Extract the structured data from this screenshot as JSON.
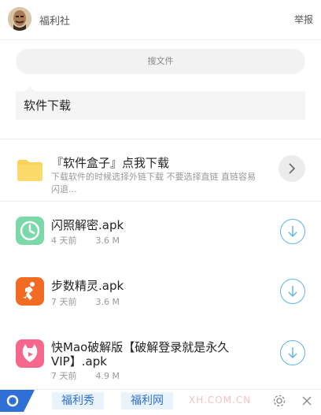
{
  "header": {
    "site_name": "福利社",
    "report_label": "举报"
  },
  "search": {
    "placeholder": "搜文件"
  },
  "folder": {
    "name": "软件下载"
  },
  "items": [
    {
      "title": "『软件盒子』点我下载",
      "desc": "下载软件的时候选择外链下载 不要选择直链 直链容易闪退...",
      "icon": "folder-icon",
      "color": "#fbd25a"
    },
    {
      "title": "闪照解密.apk",
      "time": "4 天前",
      "size": "3.6 M",
      "icon": "clock-app-icon",
      "color": "#7ad8a9"
    },
    {
      "title": "步数精灵.apk",
      "time": "7 天前",
      "size": "3.6 M",
      "icon": "runner-app-icon",
      "color": "#f26b23"
    },
    {
      "title_line1": "快Mao破解版【破解登录就是永久",
      "title_line2": "VIP】.apk",
      "time": "7 天前",
      "size": "4.9 M",
      "icon": "cat-app-icon",
      "color": "#f7678b"
    }
  ],
  "bottom_bar": {
    "tab1": "福利秀",
    "tab2": "福利网",
    "watermark": "XH.COM.CN"
  },
  "colors": {
    "accent": "#2f6fd6",
    "download": "#5ab5e8"
  }
}
